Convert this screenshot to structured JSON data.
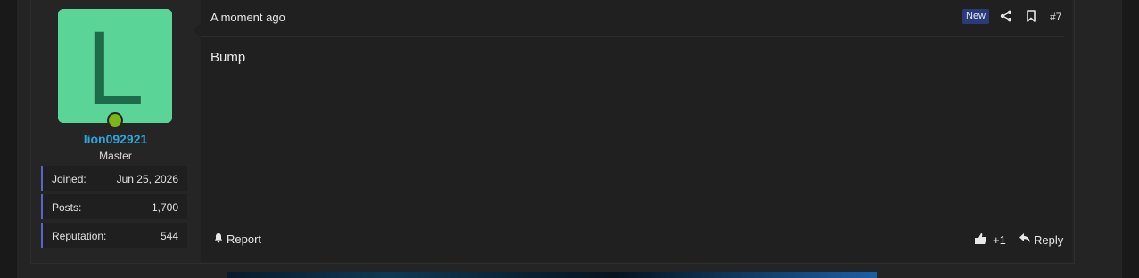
{
  "post": {
    "timestamp": "A moment ago",
    "badge": "New",
    "number": "#7",
    "message": "Bump",
    "icons": [
      "share-icon",
      "bookmark-icon",
      "bell-icon",
      "thumbs-up-icon",
      "reply-icon"
    ]
  },
  "user": {
    "avatar_letter": "L",
    "avatar_color": "#5bd497",
    "username": "lion092921",
    "title": "Master",
    "online": true,
    "stats": [
      {
        "label": "Joined:",
        "value": "Jun 25, 2026"
      },
      {
        "label": "Posts:",
        "value": "1,700"
      },
      {
        "label": "Reputation:",
        "value": "544"
      }
    ]
  },
  "actions": {
    "report_label": "Report",
    "like_label": "+1",
    "reply_label": "Reply"
  },
  "colors": {
    "username": "#2aa7dc",
    "badge_bg": "#2b3a78",
    "stat_accent": "#5c63c9",
    "online": "#7cb518"
  }
}
